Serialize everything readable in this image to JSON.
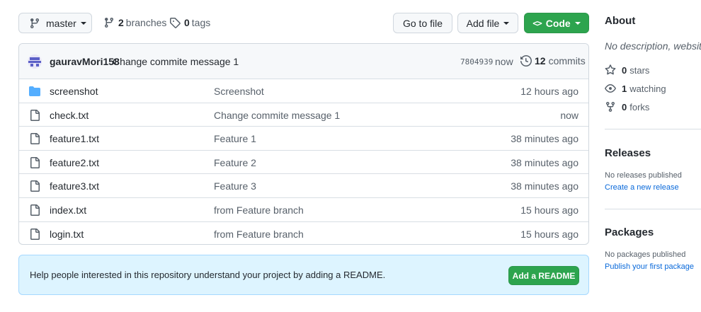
{
  "toolbar": {
    "branch": "master",
    "branches_count": "2",
    "branches_label": "branches",
    "tags_count": "0",
    "tags_label": "tags",
    "go_to_file": "Go to file",
    "add_file": "Add file",
    "code": "Code"
  },
  "commit": {
    "author": "gauravMori158",
    "message": "Change commite message 1",
    "sha": "7804939",
    "when": "now",
    "commits_count": "12",
    "commits_label": "commits"
  },
  "files": [
    {
      "type": "folder",
      "name": "screenshot",
      "message": "Screenshot",
      "age": "12 hours ago"
    },
    {
      "type": "file",
      "name": "check.txt",
      "message": "Change commite message 1",
      "age": "now"
    },
    {
      "type": "file",
      "name": "feature1.txt",
      "message": "Feature 1",
      "age": "38 minutes ago"
    },
    {
      "type": "file",
      "name": "feature2.txt",
      "message": "Feature 2",
      "age": "38 minutes ago"
    },
    {
      "type": "file",
      "name": "feature3.txt",
      "message": "Feature 3",
      "age": "38 minutes ago"
    },
    {
      "type": "file",
      "name": "index.txt",
      "message": "from Feature branch",
      "age": "15 hours ago"
    },
    {
      "type": "file",
      "name": "login.txt",
      "message": "from Feature branch",
      "age": "15 hours ago"
    }
  ],
  "readme": {
    "text": "Help people interested in this repository understand your project by adding a README.",
    "button": "Add a README"
  },
  "about": {
    "title": "About",
    "description": "No description, website",
    "stars_count": "0",
    "stars_label": "stars",
    "watching_count": "1",
    "watching_label": "watching",
    "forks_count": "0",
    "forks_label": "forks"
  },
  "releases": {
    "title": "Releases",
    "none": "No releases published",
    "link": "Create a new release"
  },
  "packages": {
    "title": "Packages",
    "none": "No packages published",
    "link": "Publish your first package"
  },
  "colors": {
    "primary_green": "#2da44e",
    "link_blue": "#0969da",
    "folder_blue": "#54aeff",
    "readme_bg": "#ddf4ff"
  }
}
